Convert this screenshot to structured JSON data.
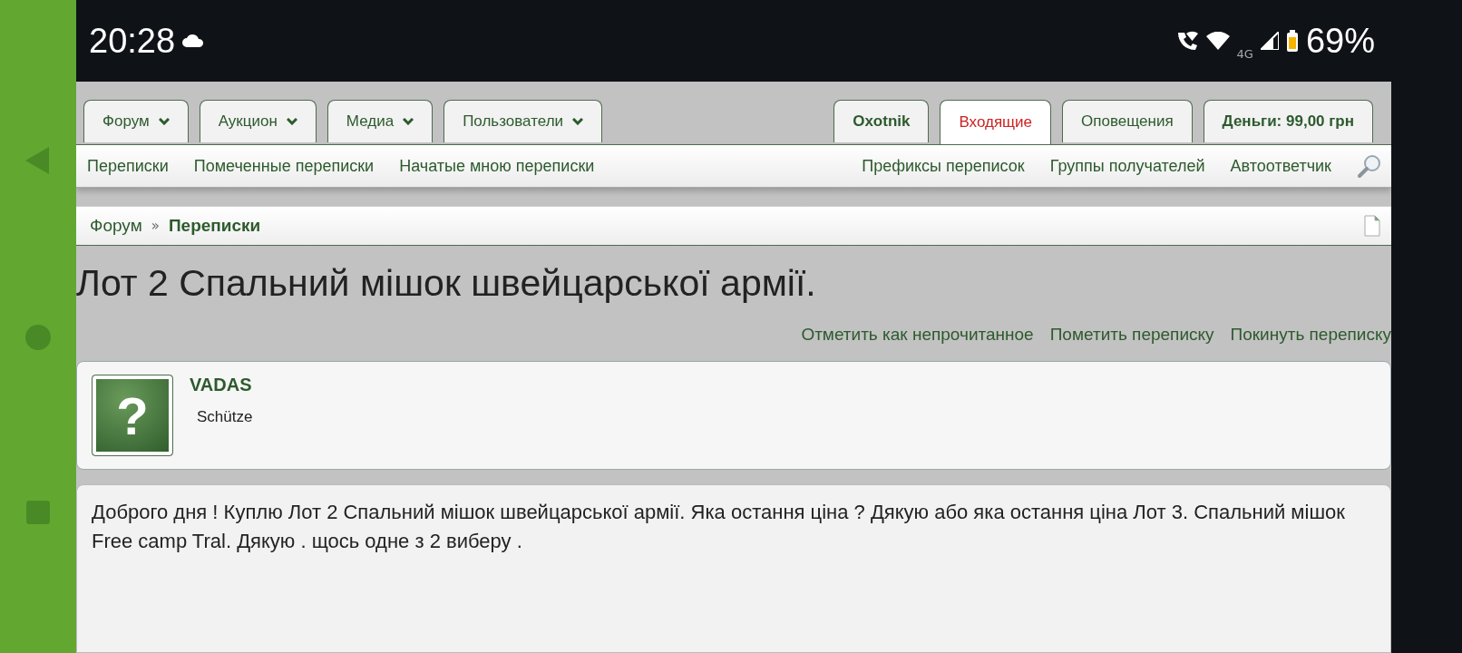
{
  "status_bar": {
    "time": "20:28",
    "network": "4G",
    "battery": "69%"
  },
  "nav_tabs": [
    {
      "label": "Форум",
      "has_menu": true,
      "bold": false,
      "selected": false
    },
    {
      "label": "Аукцион",
      "has_menu": true,
      "bold": false,
      "selected": false
    },
    {
      "label": "Медиа",
      "has_menu": true,
      "bold": false,
      "selected": false
    },
    {
      "label": "Пользователи",
      "has_menu": true,
      "bold": false,
      "selected": false
    }
  ],
  "user_tabs": [
    {
      "label": "Oxotnik",
      "has_menu": false,
      "bold": true,
      "selected": false
    },
    {
      "label": "Входящие",
      "has_menu": false,
      "bold": false,
      "selected": true
    },
    {
      "label": "Оповещения",
      "has_menu": false,
      "bold": false,
      "selected": false
    },
    {
      "label": "Деньги: 99,00 грн",
      "has_menu": false,
      "bold": true,
      "selected": false
    }
  ],
  "subnav": {
    "left": [
      "Переписки",
      "Помеченные переписки",
      "Начатые мною переписки"
    ],
    "right": [
      "Префиксы переписок",
      "Группы получателей",
      "Автоответчик"
    ]
  },
  "breadcrumb": [
    {
      "label": "Форум",
      "current": false
    },
    {
      "label": "Переписки",
      "current": true
    }
  ],
  "breadcrumb_separator": "»",
  "title": "Лот 2 Спальний мішок швейцарської армії.",
  "actions": [
    "Отметить как непрочитанное",
    "Пометить переписку",
    "Покинуть переписку"
  ],
  "participant": {
    "avatar_glyph": "?",
    "name": "VADAS",
    "rank": "Schütze"
  },
  "message": {
    "text": "Доброго дня ! Куплю Лот 2 Спальний мішок швейцарської армії. Яка остання ціна ? Дякую або яка остання ціна Лот 3. Спальний мішок Free camp Tral. Дякую . щось одне з 2 виберу ."
  }
}
